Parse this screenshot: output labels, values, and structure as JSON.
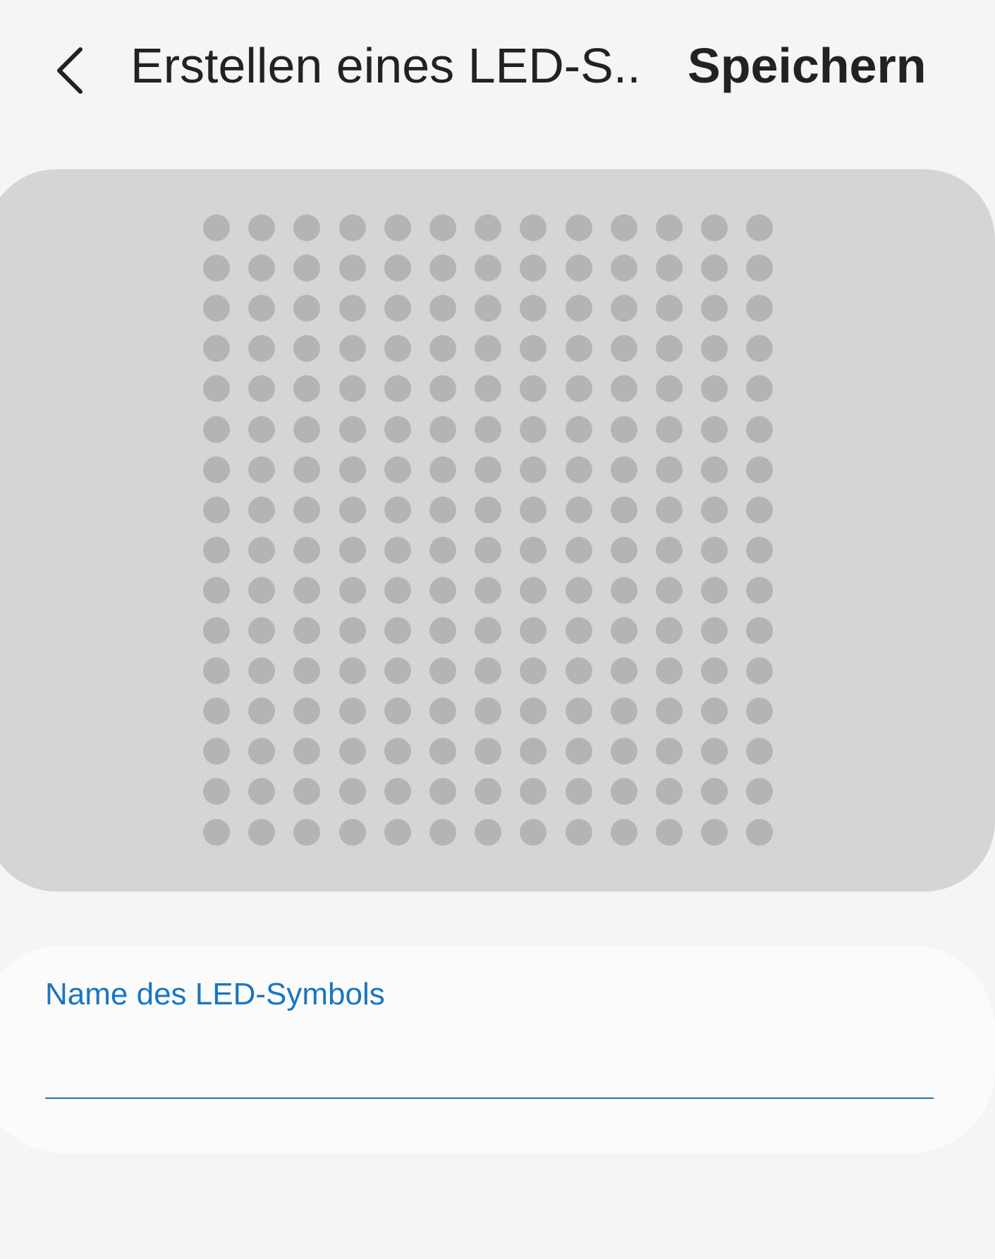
{
  "header": {
    "back_icon": "chevron-left-icon",
    "title": "Erstellen eines LED-S...",
    "save_label": "Speichern"
  },
  "led_matrix": {
    "columns": 13,
    "rows": 16,
    "dot_color": "#b4b4b4",
    "background_color": "#d5d5d5"
  },
  "name_field": {
    "label": "Name des LED-Symbols",
    "value": "",
    "accent_color": "#1976c0"
  }
}
